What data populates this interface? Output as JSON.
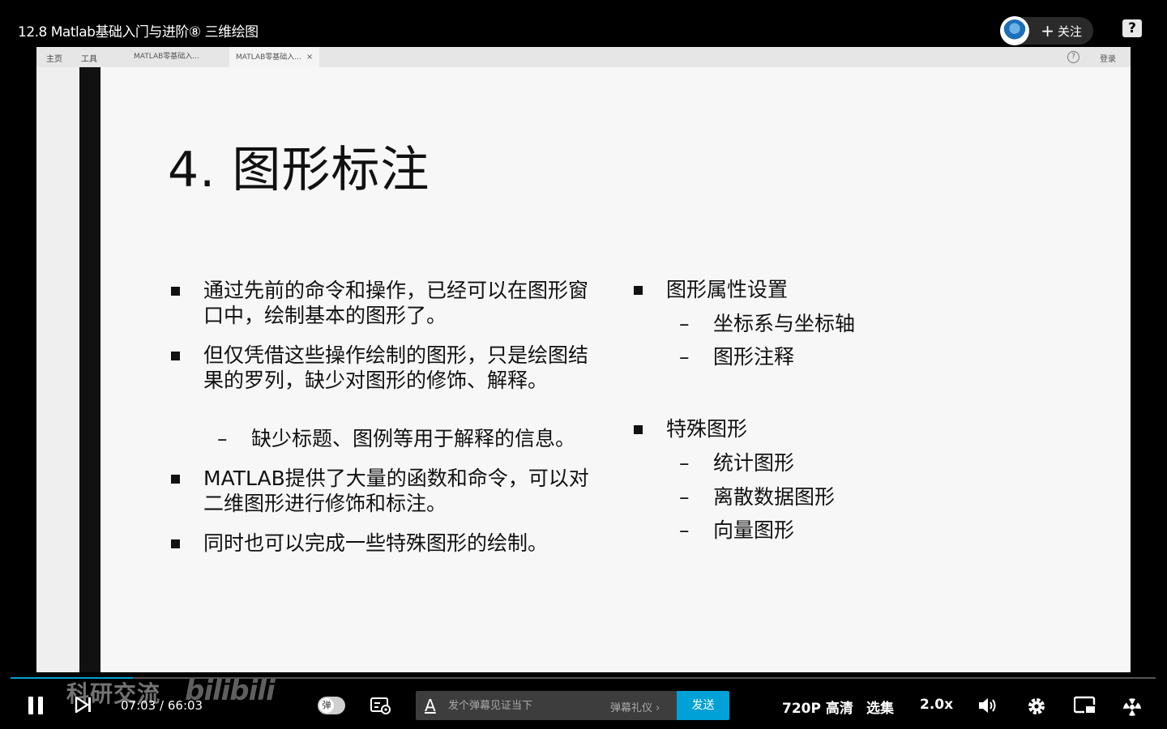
{
  "video": {
    "title": "12.8 Matlab基础入门与进阶⑧ 三维绘图",
    "follow_label": "关注",
    "follow_plus": "+",
    "help": "?"
  },
  "browser_bar": {
    "home": "主页",
    "tools": "工具",
    "tabs": [
      {
        "label": "MATLAB零基础入..."
      },
      {
        "label": "MATLAB零基础入...",
        "close": "×"
      }
    ],
    "help": "?",
    "login": "登录"
  },
  "slide": {
    "title": "4. 图形标注",
    "left_bullets": [
      {
        "text": "通过先前的命令和操作，已经可以在图形窗口中，绘制基本的图形了。"
      },
      {
        "text": "但仅凭借这些操作绘制的图形，只是绘图结果的罗列，缺少对图形的修饰、解释。"
      },
      {
        "text": "MATLAB提供了大量的函数和命令，可以对二维图形进行修饰和标注。"
      },
      {
        "text": "同时也可以完成一些特殊图形的绘制。"
      }
    ],
    "left_sub": {
      "dash": "–",
      "text": "缺少标题、图例等用于解释的信息。"
    },
    "right_groups": [
      {
        "heading": "图形属性设置",
        "items": [
          "坐标系与坐标轴",
          "图形注释"
        ]
      },
      {
        "heading": "特殊图形",
        "items": [
          "统计图形",
          "离散数据图形",
          "向量图形"
        ]
      }
    ],
    "dash": "–"
  },
  "player": {
    "watermark_channel": "科研交流",
    "watermark_logo": "bilibili",
    "current_time": "07:03",
    "separator": "/",
    "total_time": "66:03",
    "progress": 0.1067,
    "danmaku_toggle_char": "弹",
    "danmaku_placeholder": "发个弹幕见证当下",
    "danmaku_a": "A",
    "etiquette_label": "弹幕礼仪 ›",
    "send_label": "发送",
    "quality_label": "720P 高清",
    "episodes_label": "选集",
    "speed_label": "2.0x",
    "accent_color": "#00a1d6"
  }
}
